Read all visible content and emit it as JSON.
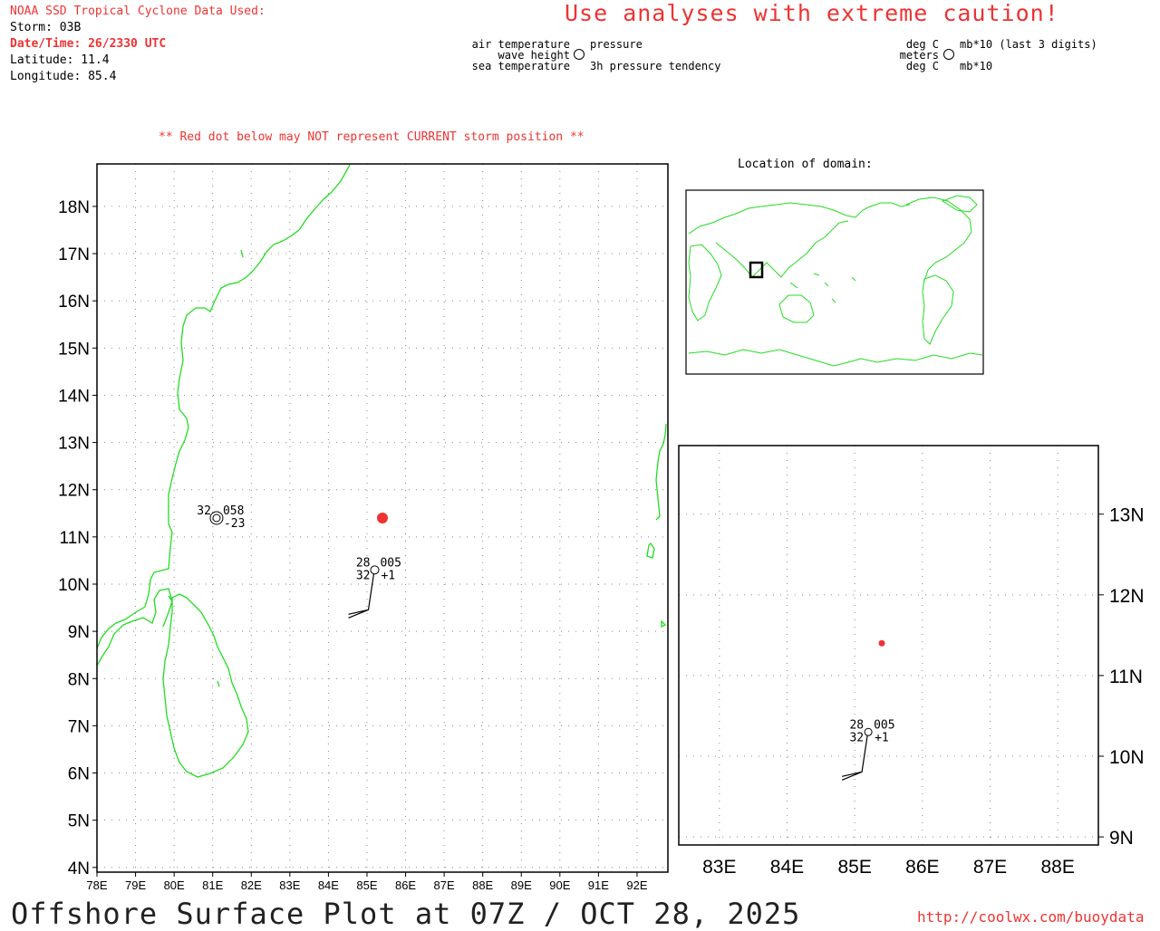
{
  "header": {
    "source": "NOAA SSD Tropical Cyclone Data Used:",
    "storm": "Storm: 03B",
    "datetime": "Date/Time: 26/2330 UTC",
    "latitude": "Latitude: 11.4",
    "longitude": "Longitude: 85.4",
    "caution": "Use analyses with extreme caution!",
    "red_dot_warning": "** Red dot below may NOT represent CURRENT storm position **"
  },
  "legend": {
    "left": {
      "top_left": "air temperature",
      "mid_left": "wave height",
      "bot_left": "sea temperature",
      "top_right": "pressure",
      "bot_right": "3h pressure tendency"
    },
    "right": {
      "top_left": "deg C",
      "mid_left": "meters",
      "bot_left": "deg C",
      "top_right": "mb*10 (last 3 digits)",
      "bot_right": "mb*10"
    }
  },
  "inset": {
    "title": "Location of domain:"
  },
  "footer": {
    "title": "Offshore Surface Plot at 07Z / OCT 28, 2025",
    "url": "http://coolwx.com/buoydata"
  },
  "colors": {
    "coast": "#22dd22",
    "storm": "#ee3333",
    "grid": "#888888"
  },
  "chart_data": {
    "type": "map",
    "main_map": {
      "lon_range": [
        78,
        92.8
      ],
      "lat_range": [
        3.9,
        18.9
      ],
      "lon_ticks": [
        "78E",
        "79E",
        "80E",
        "81E",
        "82E",
        "83E",
        "84E",
        "85E",
        "86E",
        "87E",
        "88E",
        "89E",
        "90E",
        "91E",
        "92E"
      ],
      "lat_ticks": [
        "4N",
        "5N",
        "6N",
        "7N",
        "8N",
        "9N",
        "10N",
        "11N",
        "12N",
        "13N",
        "14N",
        "15N",
        "16N",
        "17N",
        "18N"
      ],
      "storm_position": {
        "lat": 11.4,
        "lon": 85.4
      },
      "observations": [
        {
          "lat": 11.4,
          "lon": 81.1,
          "air_temp": "32",
          "pressure": "058",
          "tendency": "-23",
          "wave_height": "",
          "sea_temp": "",
          "calm": true
        },
        {
          "lat": 10.3,
          "lon": 85.2,
          "air_temp": "28",
          "pressure": "005",
          "tendency": "+1",
          "wave_height": "",
          "sea_temp": "32",
          "calm": false,
          "wind_barbs": 2
        }
      ]
    },
    "zoom_map": {
      "lon_range": [
        82.4,
        88.6
      ],
      "lat_range": [
        8.9,
        13.85
      ],
      "lon_ticks": [
        "83E",
        "84E",
        "85E",
        "86E",
        "87E",
        "88E"
      ],
      "lat_ticks": [
        "9N",
        "10N",
        "11N",
        "12N",
        "13N"
      ],
      "storm_position": {
        "lat": 11.4,
        "lon": 85.4
      },
      "observations": [
        {
          "lat": 10.3,
          "lon": 85.2,
          "air_temp": "28",
          "pressure": "005",
          "tendency": "+1",
          "sea_temp": "32",
          "wind_barbs": 2
        }
      ]
    },
    "inset_map": {
      "domain_box": {
        "lon": [
          78,
          92.8
        ],
        "lat": [
          3.9,
          18.9
        ]
      }
    }
  }
}
